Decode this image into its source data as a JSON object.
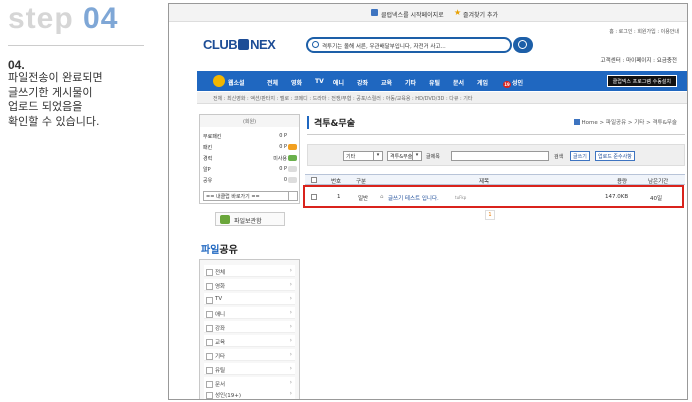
{
  "step": {
    "word": "step",
    "number": "04",
    "label": "04.",
    "desc_lines": [
      "파일전송이 완료되면",
      "글쓰기한 게시물이",
      "업로드 되었음을",
      "확인할 수 있습니다."
    ]
  },
  "site": {
    "topbar": {
      "start_page": "클럽넥스를 시작페이지로",
      "favorite": "즐겨찾기 추가"
    },
    "util_links": "홈 : 로그인 : 회원가입 : 이용안내",
    "logo": {
      "left": "CLUB",
      "right": "NEX"
    },
    "search_placeholder": "격투기는 올해 서른, 우관배달부입니다, 자전거 사고...",
    "links2": "고객센터  :  마이페이지  :  요금충전",
    "nav": {
      "first": "웹소설",
      "items": [
        "전체",
        "영화",
        "TV",
        "애니",
        "강좌",
        "교육",
        "기타",
        "유틸",
        "문서",
        "게임"
      ],
      "adult_badge": "19",
      "adult": "성인",
      "program": "클럽넥스 프로그램 수동설치"
    },
    "subnav": "전체 : 최신영화 : 액션/판타지 : 멜로 : 코메디 : 드라마 : 전쟁/무협 : 공포/스릴러 : 아동/교육용 : HD/DVD/3D : 다큐 : 기타"
  },
  "left": {
    "user_header": "(회원)",
    "rows": [
      {
        "label": "무료패킨",
        "value": "0 P",
        "tag_color": ""
      },
      {
        "label": "패킨",
        "value": "0 P",
        "tag_color": "#f2a020"
      },
      {
        "label": "경력",
        "value": "미사용",
        "tag_color": "#6ab04c"
      },
      {
        "label": "알P",
        "value": "0 P",
        "tag_color": "#cccccc"
      },
      {
        "label": "공유",
        "value": "0",
        "tag_color": "#cccccc"
      }
    ],
    "club_select": "== 내클럽 바로가기 ==",
    "file_button": "파일보관함",
    "share_title_a": "파일",
    "share_title_b": "공유",
    "categories": [
      "전체",
      "영화",
      "TV",
      "애니",
      "강좌",
      "교육",
      "기타",
      "유틸",
      "문서",
      "성인(19+)"
    ]
  },
  "main": {
    "title": "격투&무술",
    "breadcrumb": "Home  >  파일공유  >  기타  >  격투&무술",
    "filter": {
      "select1": "기타",
      "select2": "격투&무술",
      "keyword_label": "글제목",
      "search": "검색",
      "write": "글쓰기",
      "upload": "업로드 준수사항"
    },
    "table": {
      "headers": {
        "no": "번호",
        "type": "구분",
        "title": "제목",
        "size": "용량",
        "period": "남은기간"
      },
      "rows": [
        {
          "no": "1",
          "type": "일반",
          "title": "글쓰기 테스트 입니다.",
          "extra": "tuFkp",
          "size": "147.0KB",
          "period": "40일"
        }
      ]
    },
    "page": "1"
  }
}
